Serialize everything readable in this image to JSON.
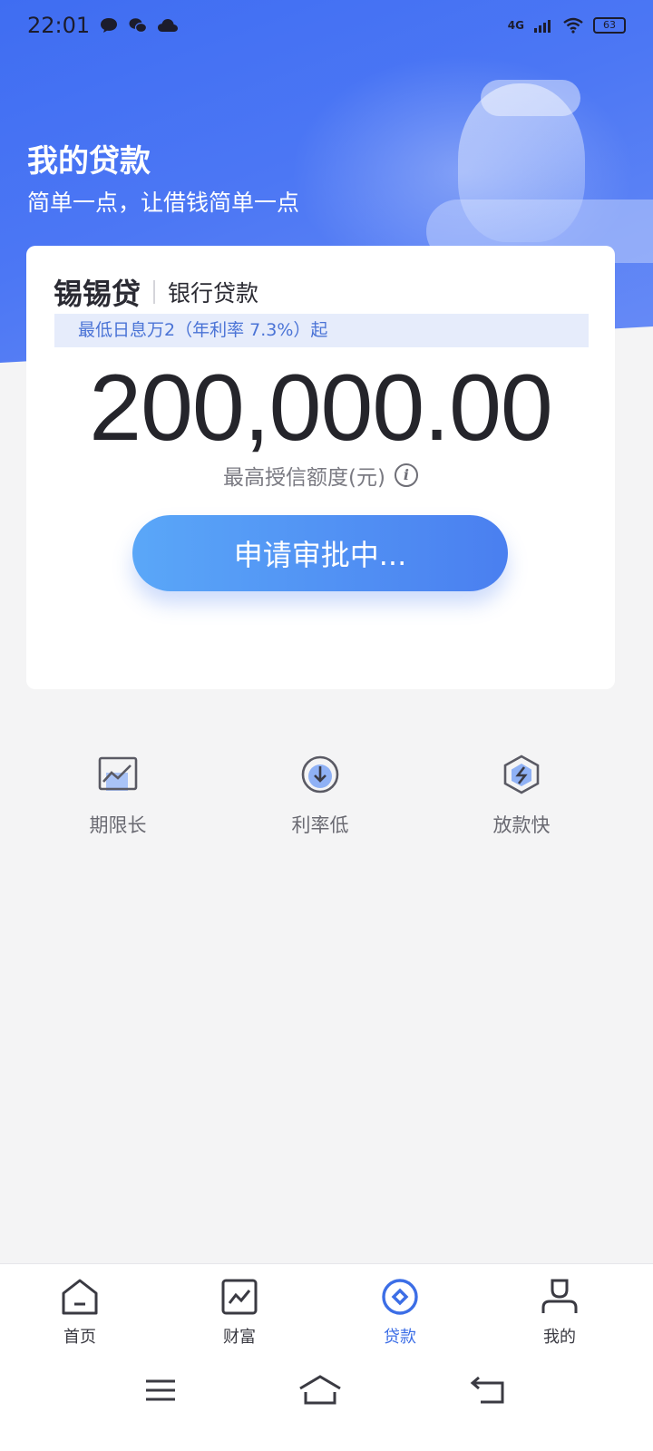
{
  "status_bar": {
    "time": "22:01",
    "network": "4G",
    "battery": "63",
    "icons": [
      "message-icon",
      "wechat-icon",
      "cloud-icon",
      "signal-icon",
      "wifi-icon",
      "battery-icon"
    ]
  },
  "header": {
    "title": "我的贷款",
    "subtitle": "简单一点，让借钱简单一点"
  },
  "loan_card": {
    "product_name": "锡锡贷",
    "product_type": "银行贷款",
    "rate_note": "最低日息万2（年利率 7.3%）起",
    "amount": "200,000.00",
    "amount_label": "最高授信额度(元)",
    "button_label": "申请审批中..."
  },
  "features": [
    {
      "label": "期限长",
      "icon": "chart-icon"
    },
    {
      "label": "利率低",
      "icon": "down-arrow-circle-icon"
    },
    {
      "label": "放款快",
      "icon": "lightning-hexagon-icon"
    }
  ],
  "tabbar": {
    "active": "贷款",
    "items": [
      {
        "label": "首页",
        "icon": "home-icon"
      },
      {
        "label": "财富",
        "icon": "wealth-chart-icon"
      },
      {
        "label": "贷款",
        "icon": "loan-icon"
      },
      {
        "label": "我的",
        "icon": "profile-icon"
      }
    ]
  },
  "colors": {
    "brand_blue": "#3f6df2",
    "active_tab": "#3c6ee6",
    "button_start": "#5aa7f8",
    "button_end": "#4a7ff0"
  }
}
